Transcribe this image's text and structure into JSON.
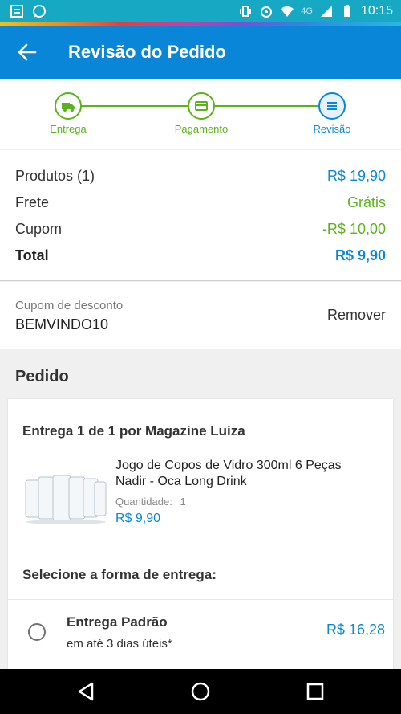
{
  "status_bar": {
    "time": "10:15",
    "network": "4G"
  },
  "app_bar": {
    "title": "Revisão do Pedido"
  },
  "stepper": {
    "steps": [
      {
        "label": "Entrega",
        "icon": "truck-icon"
      },
      {
        "label": "Pagamento",
        "icon": "card-icon"
      },
      {
        "label": "Revisão",
        "icon": "list-icon"
      }
    ]
  },
  "summary": {
    "products_label": "Produtos (1)",
    "products_value": "R$ 19,90",
    "shipping_label": "Frete",
    "shipping_value": "Grátis",
    "coupon_label": "Cupom",
    "coupon_value": "-R$ 10,00",
    "total_label": "Total",
    "total_value": "R$ 9,90"
  },
  "coupon": {
    "label": "Cupom de desconto",
    "code": "BEMVINDO10",
    "remove_label": "Remover"
  },
  "order": {
    "section_title": "Pedido",
    "delivery_title": "Entrega 1 de 1 por Magazine Luiza",
    "product": {
      "name": "Jogo de Copos de Vidro 300ml 6 Peças Nadir - Oca Long Drink",
      "quantity_label": "Quantidade:",
      "quantity": "1",
      "price": "R$ 9,90"
    },
    "select_title": "Selecione a forma de entrega:",
    "option": {
      "title": "Entrega Padrão",
      "subtitle": "em até 3 dias úteis*",
      "price": "R$ 16,28"
    }
  },
  "colors": {
    "primary": "#0a86d9",
    "green": "#5ab31c",
    "statusbar": "#17a8c4"
  }
}
